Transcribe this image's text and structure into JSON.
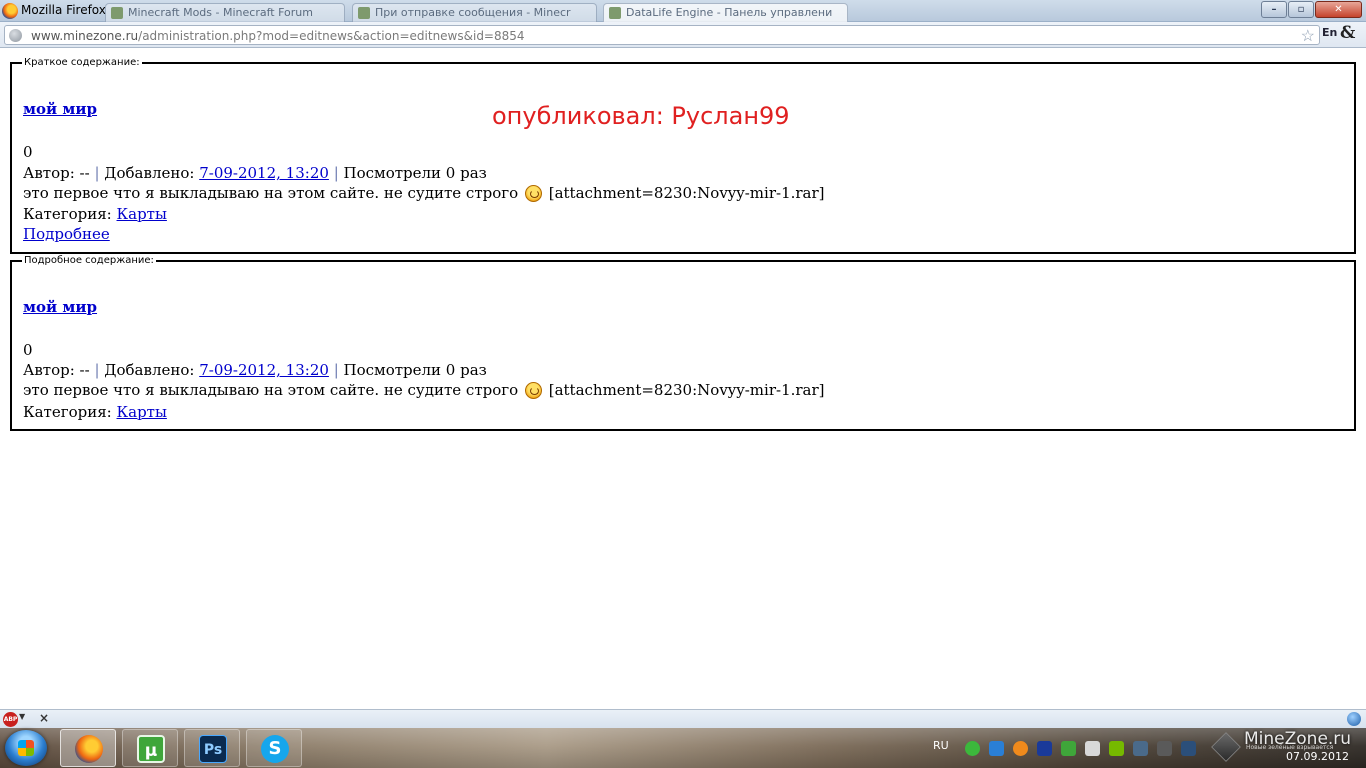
{
  "window": {
    "title": "Mozilla Firefox",
    "tabs": [
      {
        "label": "Minecraft Mods - Minecraft Forum"
      },
      {
        "label": "При отправке сообщения - Minecr"
      },
      {
        "label": "DataLife Engine - Панель управлени"
      }
    ],
    "min_label": "–",
    "max_label": "▫",
    "close_label": "✕"
  },
  "address_bar": {
    "host": "www.minezone.ru",
    "path": "/administration.php?mod=editnews&action=editnews&id=8854",
    "lang_label": "En",
    "amp_label": "&"
  },
  "short_panel": {
    "legend": "Краткое содержание:",
    "title": "мой мир",
    "rating": "0",
    "author_label": "Автор: --",
    "sep1": " | ",
    "added_label": "Добавлено: ",
    "date": "7-09-2012, 13:20",
    "sep2": " | ",
    "views": "Посмотрели 0 раз",
    "text": "это первое что я выкладываю на этом сайте. не судите строго",
    "attachment": "[attachment=8230:Novyy-mir-1.rar]",
    "category_label": "Категория: ",
    "category": "Карты",
    "more_link": "Подробнее"
  },
  "full_panel": {
    "legend": "Подробное содержание:",
    "title": "мой мир",
    "rating": "0",
    "author_label": "Автор: --",
    "sep1": " | ",
    "added_label": "Добавлено: ",
    "date": "7-09-2012, 13:20",
    "sep2": " | ",
    "views": "Посмотрели 0 раз",
    "text": "это первое что я выкладываю на этом сайте. не судите строго",
    "attachment": "[attachment=8230:Novyy-mir-1.rar]",
    "category_label": "Категория: ",
    "category": "Карты"
  },
  "overlay": {
    "published_by": "опубликовал: Руслан99"
  },
  "addon_bar": {
    "abp_label": "ABP",
    "close_label": "×"
  },
  "taskbar": {
    "apps": [
      {
        "name": "firefox",
        "glyph": ""
      },
      {
        "name": "utorrent",
        "glyph": "µ"
      },
      {
        "name": "photoshop",
        "glyph": "Ps"
      },
      {
        "name": "skype",
        "glyph": "S"
      }
    ],
    "tray_lang": "RU",
    "watermark": "MineZone.ru",
    "watermark_sub": "Новые зелёные взрывается",
    "date": "07.09.2012"
  },
  "colors": {
    "link": "#0000cc",
    "overlay_text": "#e02020",
    "titlebar": "#cfdcea"
  }
}
